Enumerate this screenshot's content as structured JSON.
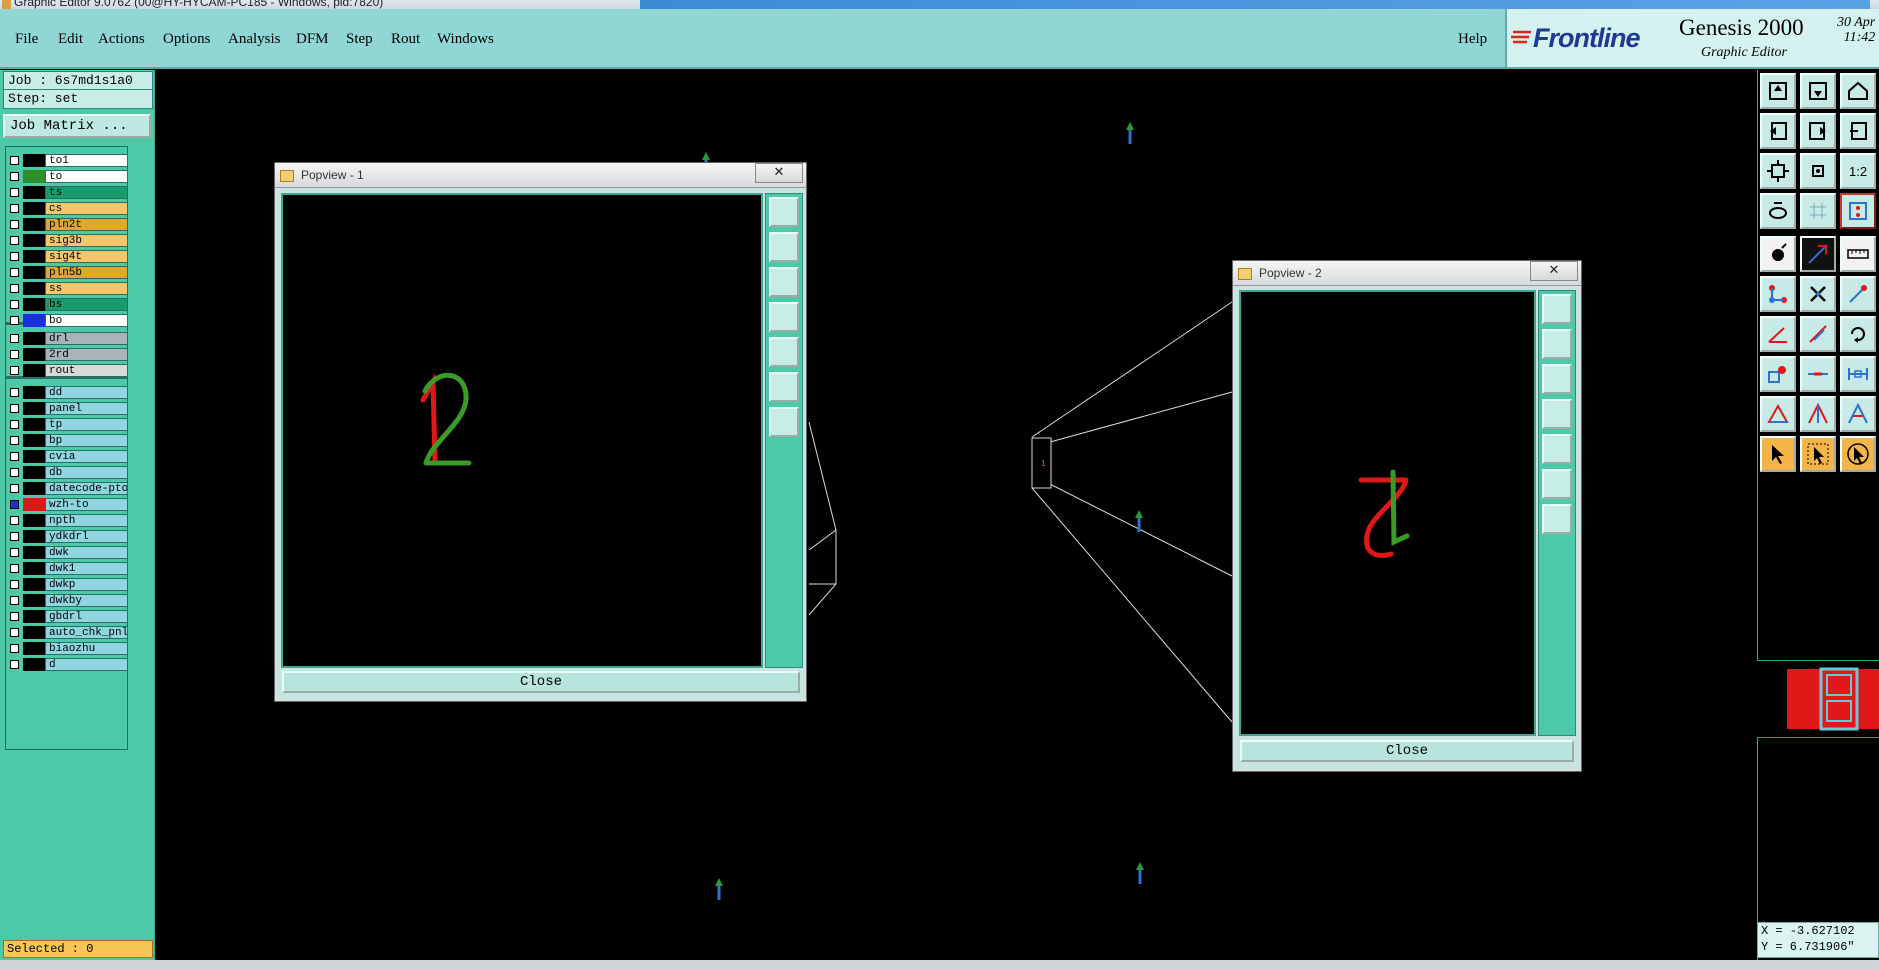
{
  "window": {
    "title": "Graphic Editor 9.0762 (00@HY-HYCAM-PC185 - Windows, pid:7820)"
  },
  "menu": [
    "File",
    "Edit",
    "Actions",
    "Options",
    "Analysis",
    "DFM",
    "Step",
    "Rout",
    "Windows"
  ],
  "help_label": "Help",
  "brand": {
    "logo": "Frontline",
    "product": "Genesis 2000",
    "subtitle": "Graphic Editor",
    "date_line1": "30 Apr",
    "date_line2": "11:42"
  },
  "job": {
    "job_label": "Job : 6s7md1s1a0",
    "step_label": "Step: set"
  },
  "job_matrix_label": "Job Matrix ...",
  "layers_board": [
    {
      "name": "to1",
      "swatch": "#000000",
      "bg": "#ffffff"
    },
    {
      "name": "to",
      "swatch": "#2f8f2a",
      "bg": "#ffffff"
    },
    {
      "name": "ts",
      "swatch": "#000000",
      "bg": "#1a9a6e"
    },
    {
      "name": "cs",
      "swatch": "#000000",
      "bg": "#f5c66a"
    },
    {
      "name": "pln2t",
      "swatch": "#000000",
      "bg": "#e0a82a"
    },
    {
      "name": "sig3b",
      "swatch": "#000000",
      "bg": "#f5c66a"
    },
    {
      "name": "sig4t",
      "swatch": "#000000",
      "bg": "#f5c66a"
    },
    {
      "name": "pln5b",
      "swatch": "#000000",
      "bg": "#e0a82a"
    },
    {
      "name": "ss",
      "swatch": "#000000",
      "bg": "#f5c66a"
    },
    {
      "name": "bs",
      "swatch": "#000000",
      "bg": "#1a9a6e"
    },
    {
      "name": "bo",
      "swatch": "#1b2fe0",
      "bg": "#ffffff"
    }
  ],
  "layers_drill": [
    {
      "name": "drl",
      "swatch": "#000000",
      "bg": "#a9b4ba"
    },
    {
      "name": "2rd",
      "swatch": "#000000",
      "bg": "#a9b4ba"
    },
    {
      "name": "rout",
      "swatch": "#000000",
      "bg": "#d9d9d9"
    }
  ],
  "layers_misc": [
    {
      "name": "dd",
      "swatch": "#000000",
      "bg": "#8fd6e0"
    },
    {
      "name": "panel",
      "swatch": "#000000",
      "bg": "#8fd6e0"
    },
    {
      "name": "tp",
      "swatch": "#000000",
      "bg": "#8fd6e0"
    },
    {
      "name": "bp",
      "swatch": "#000000",
      "bg": "#8fd6e0"
    },
    {
      "name": "cvia",
      "swatch": "#000000",
      "bg": "#8fd6e0"
    },
    {
      "name": "db",
      "swatch": "#000000",
      "bg": "#8fd6e0"
    },
    {
      "name": "datecode-pto",
      "swatch": "#000000",
      "bg": "#8fd6e0"
    },
    {
      "name": "wzh-to",
      "swatch": "#e01818",
      "bg": "#8fd6e0",
      "active": true
    },
    {
      "name": "npth",
      "swatch": "#000000",
      "bg": "#8fd6e0"
    },
    {
      "name": "ydkdrl",
      "swatch": "#000000",
      "bg": "#8fd6e0"
    },
    {
      "name": "dwk",
      "swatch": "#000000",
      "bg": "#8fd6e0"
    },
    {
      "name": "dwk1",
      "swatch": "#000000",
      "bg": "#8fd6e0"
    },
    {
      "name": "dwkp",
      "swatch": "#000000",
      "bg": "#8fd6e0"
    },
    {
      "name": "dwkby",
      "swatch": "#000000",
      "bg": "#8fd6e0"
    },
    {
      "name": "gbdrl",
      "swatch": "#000000",
      "bg": "#8fd6e0"
    },
    {
      "name": "auto_chk_pnl",
      "swatch": "#000000",
      "bg": "#8fd6e0"
    },
    {
      "name": "biaozhu",
      "swatch": "#000000",
      "bg": "#8fd6e0"
    },
    {
      "name": "d",
      "swatch": "#000000",
      "bg": "#8fd6e0"
    }
  ],
  "selected_label": "Selected : 0",
  "popview1": {
    "title": "Popview - 1",
    "close_label": "Close",
    "close_x": "✕"
  },
  "popview2": {
    "title": "Popview - 2",
    "close_label": "Close",
    "close_x": "✕"
  },
  "coords": {
    "x_label": "X = -3.627102",
    "y_label": "Y = 6.731906\""
  },
  "colors": {
    "menubar": "#8fd6d4",
    "panel": "#4ec9a8",
    "toolbar_button": "#c8eae6",
    "highlight": "#f3b44a"
  }
}
